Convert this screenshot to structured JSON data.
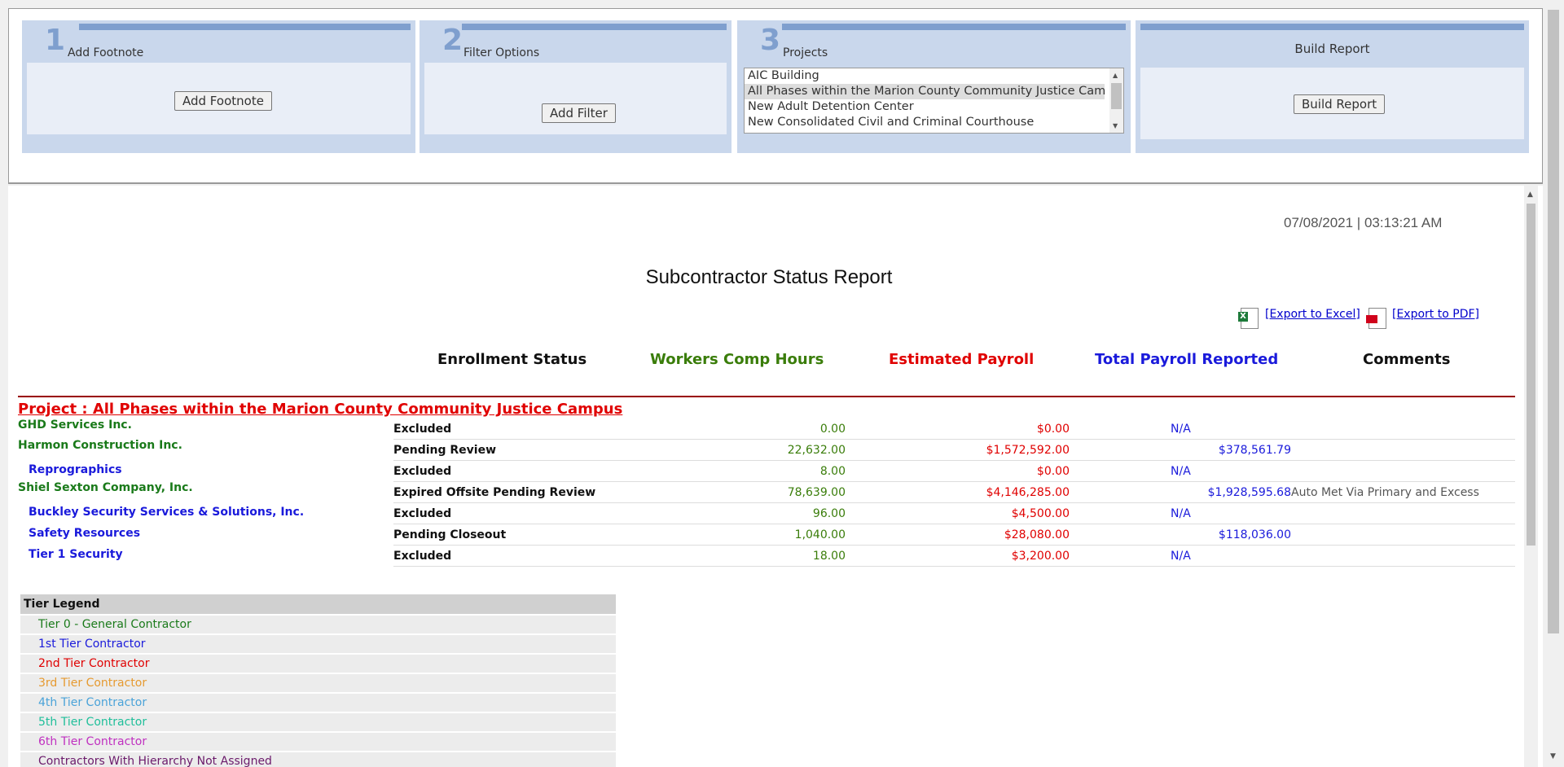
{
  "steps": [
    {
      "num": "1",
      "title": "Add Footnote",
      "button": "Add Footnote"
    },
    {
      "num": "2",
      "title": "Filter Options",
      "button": "Add Filter"
    },
    {
      "num": "3",
      "title": "Projects"
    },
    {
      "title": "Build Report",
      "button": "Build Report"
    }
  ],
  "projects_list": [
    {
      "label": "AIC Building",
      "selected": false
    },
    {
      "label": "All Phases within the Marion County Community Justice Campus",
      "selected": true
    },
    {
      "label": "New Adult Detention Center",
      "selected": false
    },
    {
      "label": "New Consolidated Civil and Criminal Courthouse",
      "selected": false
    }
  ],
  "report": {
    "timestamp": "07/08/2021 | 03:13:21 AM",
    "title": "Subcontractor Status Report",
    "export_excel": "[Export to Excel]",
    "export_pdf": "[Export to PDF]",
    "columns": {
      "enrollment": "Enrollment Status",
      "hours": "Workers Comp Hours",
      "estimated": "Estimated Payroll",
      "reported": "Total Payroll Reported",
      "comments": "Comments"
    },
    "project": "Project : All Phases within the Marion County Community Justice Campus",
    "rows": [
      {
        "name": "GHD Services Inc.",
        "tier": 0,
        "status": "Excluded",
        "hours": "0.00",
        "estimated": "$0.00",
        "reported": "N/A",
        "comments": ""
      },
      {
        "name": "Harmon Construction Inc.",
        "tier": 0,
        "status": "Pending Review",
        "hours": "22,632.00",
        "estimated": "$1,572,592.00",
        "reported": "$378,561.79",
        "comments": ""
      },
      {
        "name": "Reprographics",
        "tier": 1,
        "status": "Excluded",
        "hours": "8.00",
        "estimated": "$0.00",
        "reported": "N/A",
        "comments": ""
      },
      {
        "name": "Shiel Sexton Company, Inc.",
        "tier": 0,
        "status": "Expired Offsite Pending Review",
        "hours": "78,639.00",
        "estimated": "$4,146,285.00",
        "reported": "$1,928,595.68",
        "comments": "Auto Met Via Primary and Excess"
      },
      {
        "name": "Buckley Security Services & Solutions, Inc.",
        "tier": 1,
        "status": "Excluded",
        "hours": "96.00",
        "estimated": "$4,500.00",
        "reported": "N/A",
        "comments": ""
      },
      {
        "name": "Safety Resources",
        "tier": 1,
        "status": "Pending Closeout",
        "hours": "1,040.00",
        "estimated": "$28,080.00",
        "reported": "$118,036.00",
        "comments": ""
      },
      {
        "name": "Tier 1 Security",
        "tier": 1,
        "status": "Excluded",
        "hours": "18.00",
        "estimated": "$3,200.00",
        "reported": "N/A",
        "comments": ""
      }
    ],
    "legend": {
      "title": "Tier Legend",
      "items": [
        {
          "label": "Tier 0 - General Contractor",
          "color": "#1a7a1a"
        },
        {
          "label": "1st Tier Contractor",
          "color": "#1a1adb"
        },
        {
          "label": "2nd Tier Contractor",
          "color": "#e00000"
        },
        {
          "label": "3rd Tier Contractor",
          "color": "#e69a30"
        },
        {
          "label": "4th Tier Contractor",
          "color": "#4aa3d9"
        },
        {
          "label": "5th Tier Contractor",
          "color": "#1fbf9a"
        },
        {
          "label": "6th Tier Contractor",
          "color": "#c030c0"
        },
        {
          "label": "Contractors With Hierarchy Not Assigned",
          "color": "#6b1a6b"
        }
      ]
    }
  },
  "colors": {
    "hours": "#3a7d0a",
    "estimated": "#e00000",
    "reported": "#1a1adb",
    "tier0": "#1a7a1a",
    "tier1": "#1a1adb"
  }
}
